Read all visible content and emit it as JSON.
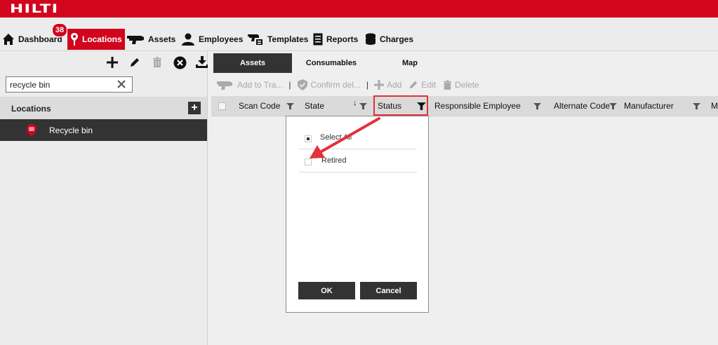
{
  "brand": {
    "logo": "HILTI",
    "accent": "#d2051e"
  },
  "nav": {
    "items": [
      {
        "label": "Dashboard",
        "icon": "home-icon"
      },
      {
        "label": "Locations",
        "icon": "location-pin-icon",
        "active": true
      },
      {
        "label": "Assets",
        "icon": "tool-icon"
      },
      {
        "label": "Employees",
        "icon": "person-icon"
      },
      {
        "label": "Templates",
        "icon": "template-icon"
      },
      {
        "label": "Reports",
        "icon": "report-icon"
      },
      {
        "label": "Charges",
        "icon": "database-icon"
      }
    ],
    "badge": "38"
  },
  "left_panel": {
    "search_value": "recycle bin",
    "locations_header": "Locations",
    "rows": [
      {
        "label": "Recycle bin",
        "icon": "recycle-location-pin-icon"
      }
    ]
  },
  "right_panel": {
    "tabs": [
      {
        "label": "Assets",
        "active": true
      },
      {
        "label": "Consumables"
      },
      {
        "label": "Map"
      }
    ],
    "actions": {
      "add_to_transfer": "Add to Tra...",
      "confirm_delivery": "Confirm del...",
      "add": "Add",
      "edit": "Edit",
      "delete": "Delete"
    },
    "columns": {
      "scan_code": "Scan Code",
      "state": "State",
      "status": "Status",
      "responsible_employee": "Responsible Employee",
      "alternate_code": "Alternate Code",
      "manufacturer": "Manufacturer",
      "more": "M"
    }
  },
  "filter_popup": {
    "select_all": "Select All",
    "options": [
      {
        "label": "Retired",
        "checked": false
      }
    ],
    "ok": "OK",
    "cancel": "Cancel"
  },
  "annotation_color": "#e2323a"
}
